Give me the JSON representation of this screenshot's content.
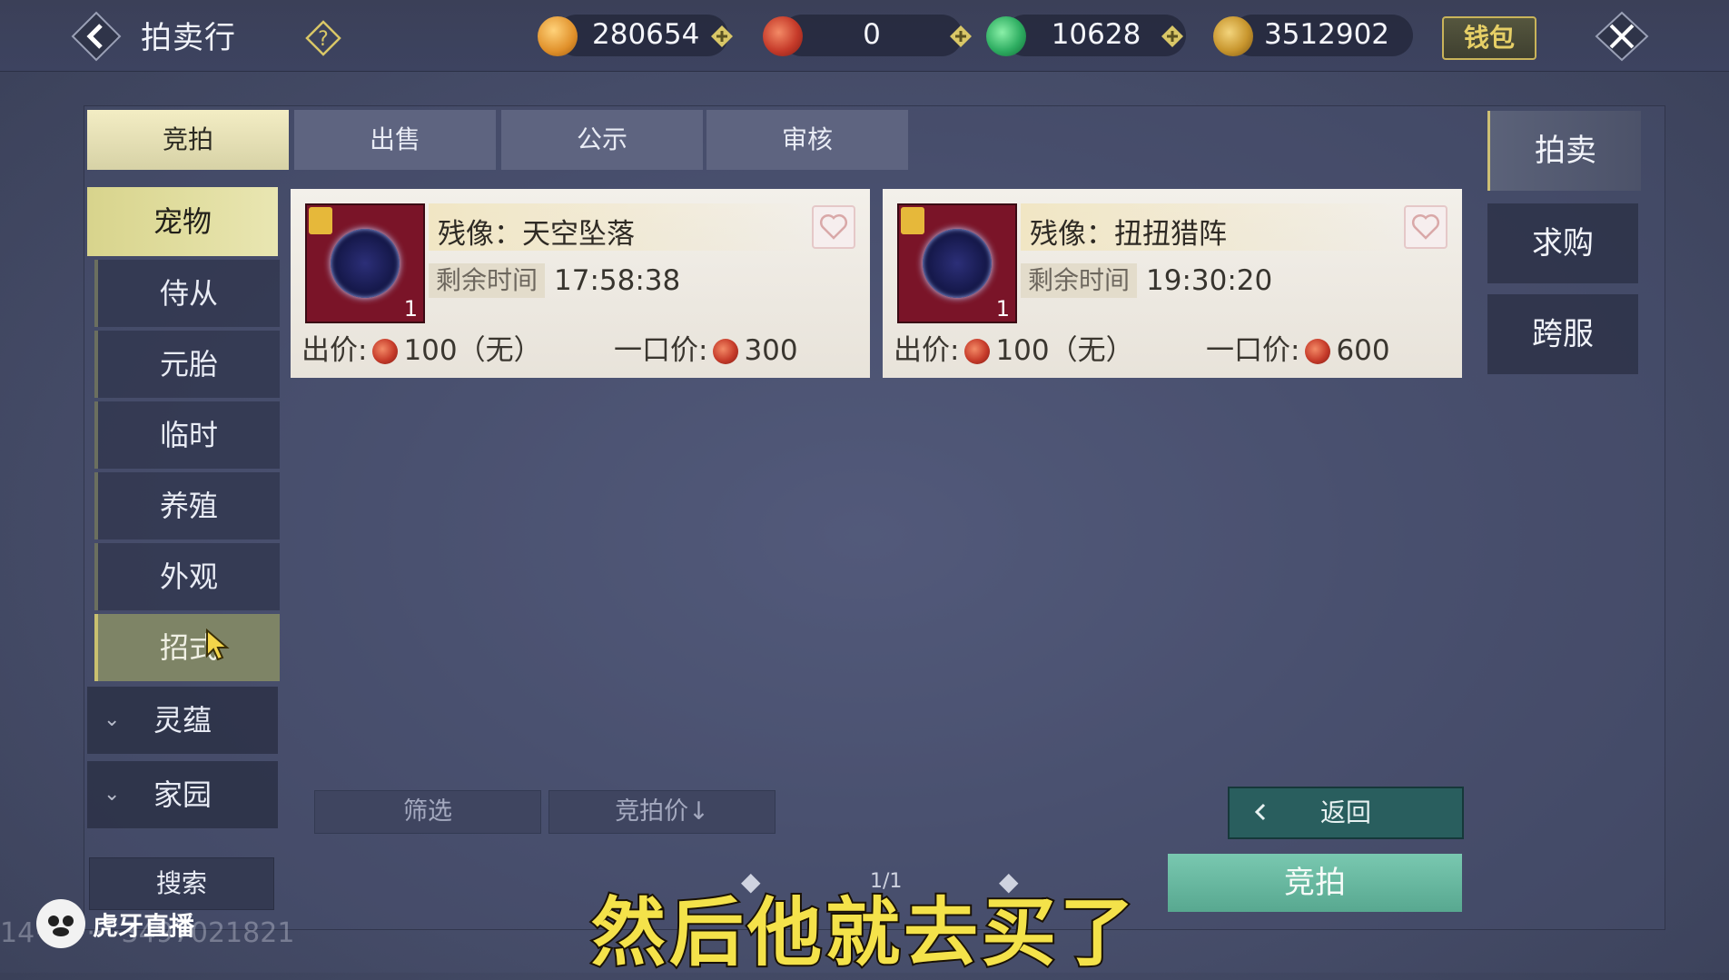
{
  "header": {
    "title": "拍卖行",
    "wallet_label": "钱包",
    "currencies": [
      {
        "icon": "gold-ingot-icon",
        "value": "280654"
      },
      {
        "icon": "red-swirl-coin-icon",
        "value": "0"
      },
      {
        "icon": "jade-coin-icon",
        "value": "10628"
      },
      {
        "icon": "gold-leaf-icon",
        "value": "3512902"
      }
    ]
  },
  "tabs": [
    "竞拍",
    "出售",
    "公示",
    "审核"
  ],
  "categories": [
    {
      "label": "宠物",
      "state": "active"
    },
    {
      "label": "侍从",
      "state": "sub"
    },
    {
      "label": "元胎",
      "state": "sub"
    },
    {
      "label": "临时",
      "state": "sub"
    },
    {
      "label": "养殖",
      "state": "sub"
    },
    {
      "label": "外观",
      "state": "sub"
    },
    {
      "label": "招式",
      "state": "selected"
    },
    {
      "label": "灵蕴",
      "state": "collapsed"
    },
    {
      "label": "家园",
      "state": "collapsed"
    }
  ],
  "right_tabs": [
    "拍卖",
    "求购",
    "跨服"
  ],
  "items": [
    {
      "name": "残像：天空坠落",
      "time_label": "剩余时间",
      "time_left": "17:58:38",
      "bid_label": "出价:",
      "bid_value": "100（无）",
      "buyout_label": "一口价:",
      "buyout_value": "300",
      "quantity": "1"
    },
    {
      "name": "残像：扭扭猎阵",
      "time_label": "剩余时间",
      "time_left": "19:30:20",
      "bid_label": "出价:",
      "bid_value": "100（无）",
      "buyout_label": "一口价:",
      "buyout_value": "600",
      "quantity": "1"
    }
  ],
  "controls": {
    "filter_label": "筛选",
    "sort_label": "竞拍价↓",
    "return_label": "返回",
    "bid_label": "竞拍",
    "search_label": "搜索",
    "page": "1/1"
  },
  "overlay": {
    "subtitle": "然后他就去买了",
    "watermark_text": "虎牙直播",
    "watermark_id": "14··········3497021821"
  }
}
